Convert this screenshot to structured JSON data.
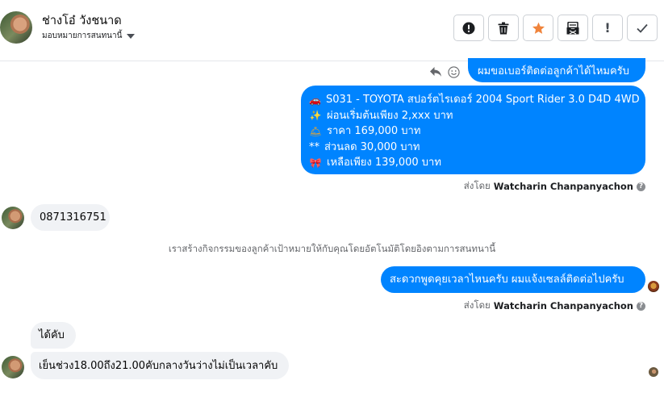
{
  "header": {
    "contact_name": "ช่างโอ๋ วังชนาด",
    "assign_label": "มอบหมายการสนทนานี้"
  },
  "toolbar": {
    "buttons": [
      {
        "name": "mark-spam",
        "icon": "alert-circle-icon"
      },
      {
        "name": "delete",
        "icon": "trash-icon"
      },
      {
        "name": "star",
        "icon": "star-icon",
        "color": "#f0843c"
      },
      {
        "name": "archive",
        "icon": "archive-icon"
      },
      {
        "name": "mark-unread",
        "icon": "exclamation-icon",
        "text": "!"
      },
      {
        "name": "done",
        "icon": "check-icon"
      }
    ]
  },
  "messages": {
    "out1": {
      "text": "ผมขอเบอร์ติดต่อลูกค้าได้ไหมครับ"
    },
    "out2": {
      "lines": [
        {
          "emoji": "car-icon",
          "glyph": "🚗",
          "text": "S031 - TOYOTA สปอร์ตไรเดอร์ 2004 Sport Rider 3.0 D4D 4WD"
        },
        {
          "emoji": "sparkles-icon",
          "glyph": "✨",
          "text": "ผ่อนเริ่มต้นเพียง 2,xxx บาท"
        },
        {
          "emoji": "bell-icon",
          "glyph": "🛎",
          "text": "ราคา 169,000 บาท"
        },
        {
          "emoji": "",
          "glyph": "**",
          "text": "ส่วนลด 30,000 บาท"
        },
        {
          "emoji": "ribbon-icon",
          "glyph": "🎀",
          "text": "เหลือเพียง 139,000 บาท"
        }
      ]
    },
    "sent_by_1": {
      "prefix": "ส่งโดย",
      "name": "Watcharin Chanpanyachon"
    },
    "in1": {
      "text": "0871316751"
    },
    "system_note": "เราสร้างกิจกรรมของลูกค้าเป้าหมายให้กับคุณโดยอัตโนมัติโดยอิงตามการสนทนานี้",
    "out3": {
      "text": "สะดวกพูดคุยเวลาไหนครับ ผมแจ้งเซลล์ติดต่อไปครับ"
    },
    "sent_by_2": {
      "prefix": "ส่งโดย",
      "name": "Watcharin Chanpanyachon"
    },
    "in2": {
      "text": "ได้คับ"
    },
    "in3": {
      "text": "เย็นช่วง18.00ถึง21.00คับกลางวันว่างไม่เป็นเวลาคับ"
    }
  },
  "colors": {
    "outgoing_bubble": "#0084ff",
    "incoming_bubble": "#f0f2f5",
    "star_accent": "#f0843c"
  }
}
